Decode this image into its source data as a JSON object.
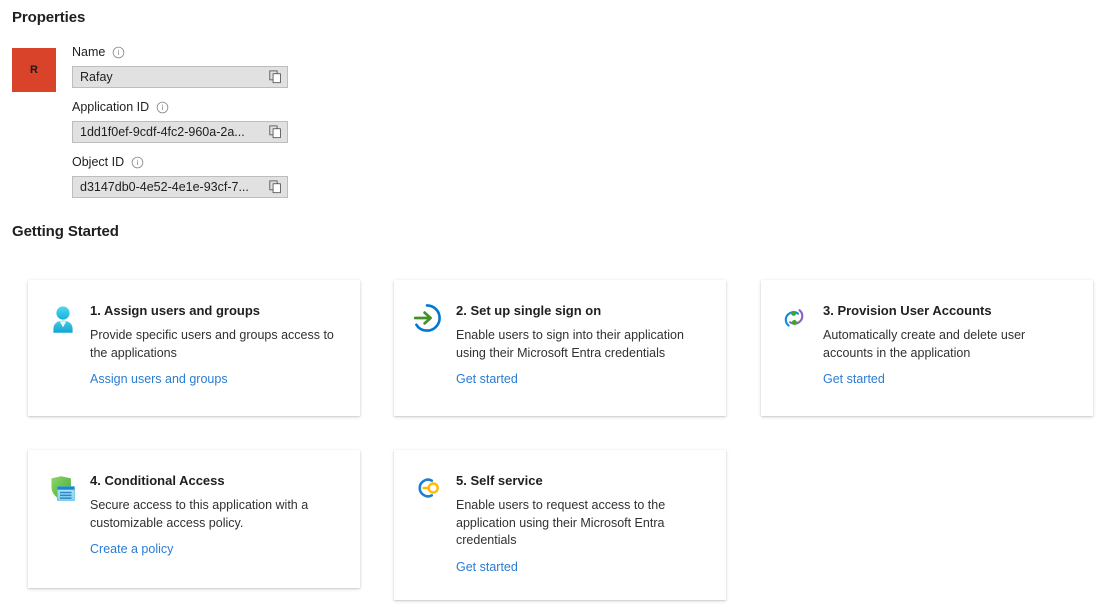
{
  "sections": {
    "properties_heading": "Properties",
    "getting_started_heading": "Getting Started"
  },
  "app": {
    "logo_initial": "R",
    "logo_color": "#d8432a"
  },
  "properties": {
    "fields": [
      {
        "label": "Name",
        "value": "Rafay",
        "info_icon": "info-circle-icon",
        "copy_icon": "copy-icon",
        "copy_label": "Copy to clipboard"
      },
      {
        "label": "Application ID",
        "value": "1dd1f0ef-9cdf-4fc2-960a-2a...",
        "info_icon": "info-circle-icon",
        "copy_icon": "copy-icon",
        "copy_label": "Copy to clipboard"
      },
      {
        "label": "Object ID",
        "value": "d3147db0-4e52-4e1e-93cf-7...",
        "info_icon": "info-circle-icon",
        "copy_icon": "copy-icon",
        "copy_label": "Copy to clipboard"
      }
    ]
  },
  "getting_started": {
    "cards": [
      {
        "title": "1. Assign users and groups",
        "description": "Provide specific users and groups access to the applications",
        "link": "Assign users and groups",
        "icon": "user-person-icon"
      },
      {
        "title": "2. Set up single sign on",
        "description": "Enable users to sign into their application using their Microsoft Entra credentials",
        "link": "Get started",
        "icon": "single-sign-on-arrow-icon"
      },
      {
        "title": "3. Provision User Accounts",
        "description": "Automatically create and delete user accounts in the application",
        "link": "Get started",
        "icon": "provisioning-sync-icon"
      },
      {
        "title": "4. Conditional Access",
        "description": "Secure access to this application with a customizable access policy.",
        "link": "Create a policy",
        "icon": "shield-policy-icon"
      },
      {
        "title": "5. Self service",
        "description": "Enable users to request access to the application using their Microsoft Entra credentials",
        "link": "Get started",
        "icon": "self-service-key-icon"
      }
    ]
  },
  "colors": {
    "link": "#2a7cd4",
    "text": "#201f1e",
    "field_bg": "#e1e1e1",
    "field_border": "#bdbdbd",
    "icon_cyan": "#32bedd",
    "icon_green": "#5e9624",
    "icon_blue": "#0078d4",
    "icon_purple": "#8661c5",
    "icon_gold": "#ffb900",
    "shield_green": "#5cb335"
  }
}
